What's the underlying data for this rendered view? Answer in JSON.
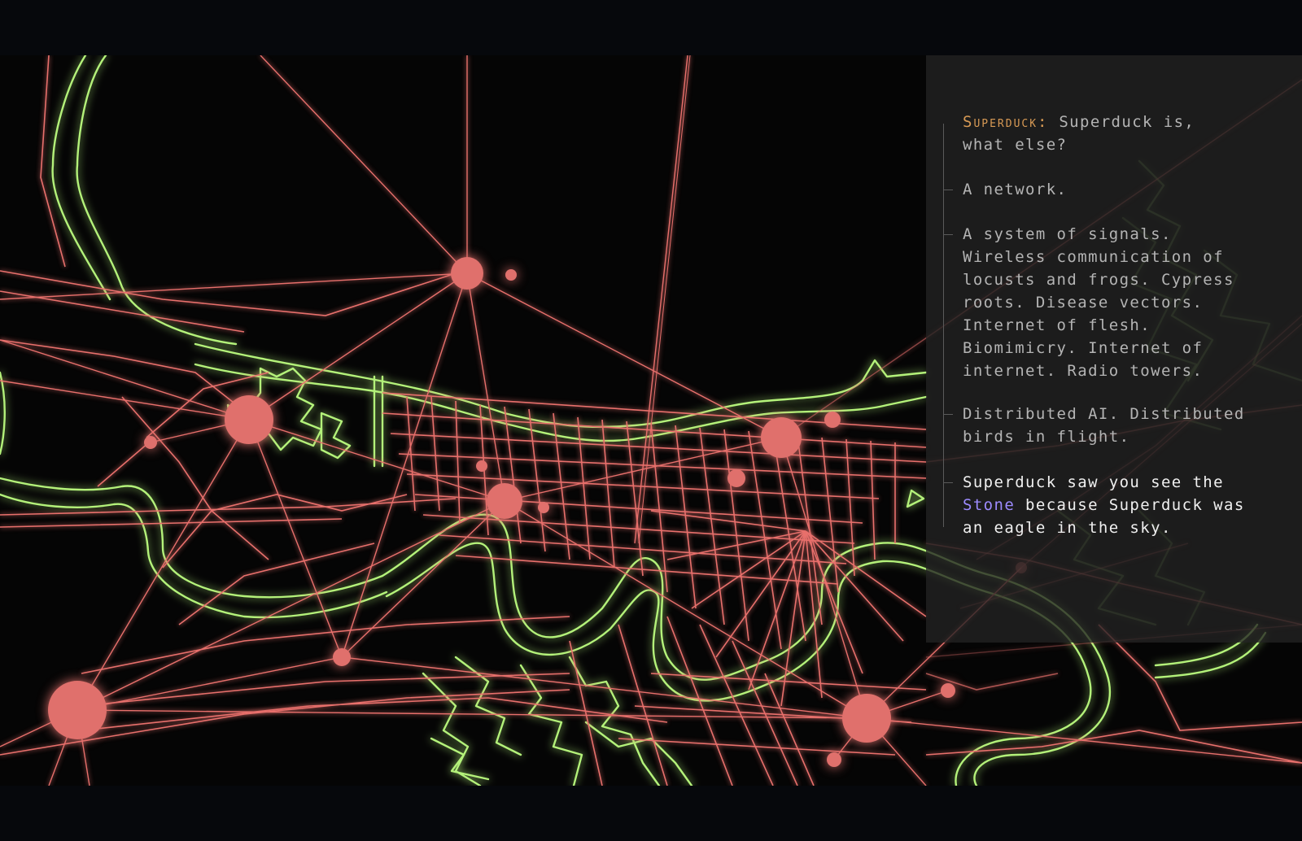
{
  "colors": {
    "background": "#050505",
    "letterbox": "#06080c",
    "roads": "#e8706c",
    "river_and_coast": "#b4f27a",
    "panel": "#222222",
    "panel_text": "#b4b4b4",
    "panel_text_bright": "#f0f0f0",
    "speaker": "#d89a55",
    "link": "#9d8bff"
  },
  "map": {
    "style": "neon network map",
    "layers": [
      "river-and-coast",
      "road-grid",
      "network-links",
      "network-nodes"
    ]
  },
  "dialogue": {
    "speaker": "Superduck:",
    "line1": "Superduck is,\nwhat else?",
    "line2": "A network.",
    "line3": "A system of signals.\nWireless communication of\nlocusts and frogs. Cypress\nroots. Disease vectors.\nInternet of flesh.\nBiomimicry. Internet of\ninternet. Radio towers.",
    "line4": "Distributed AI. Distributed\nbirds in flight.",
    "line5_before": "Superduck saw you see the\n",
    "line5_link": "Stone",
    "line5_after": " because Superduck was\nan eagle in the sky."
  }
}
